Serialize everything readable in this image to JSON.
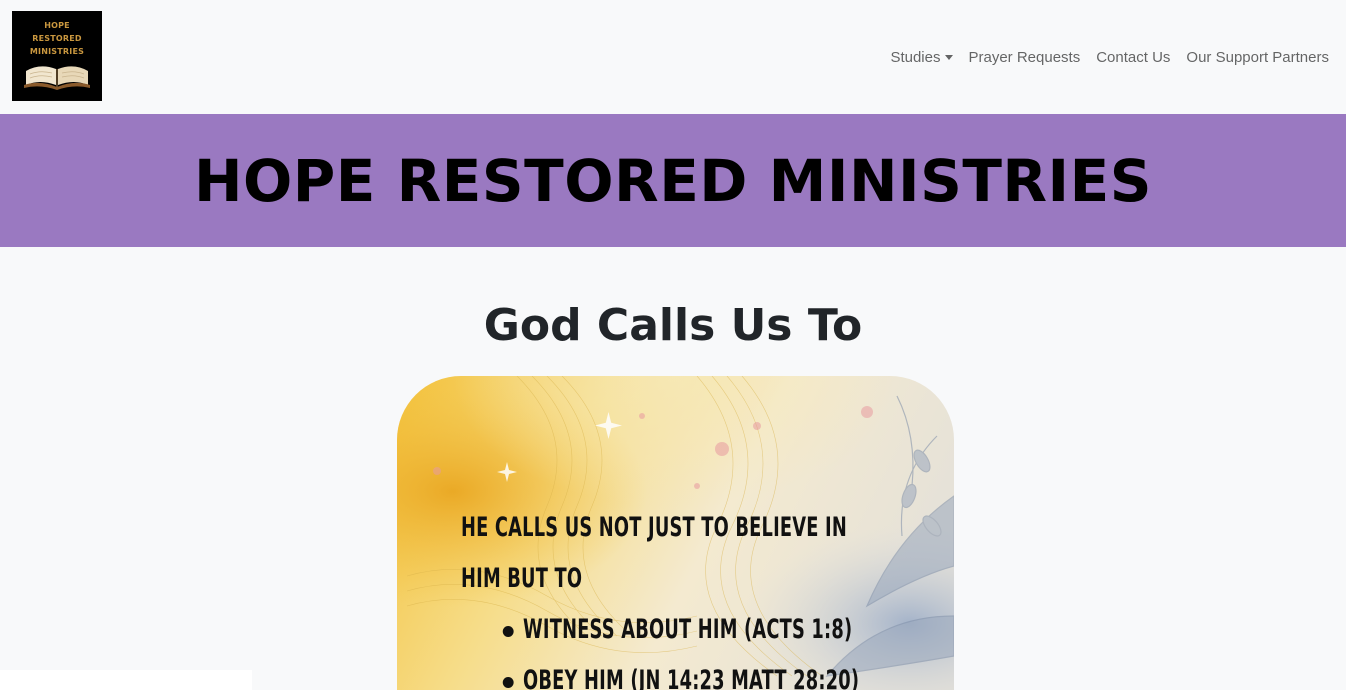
{
  "logo": {
    "alt": "Hope Restored Ministries logo",
    "lines": [
      "HOPE",
      "RESTORED",
      "MINISTRIES"
    ]
  },
  "nav": {
    "items": [
      {
        "label": "Studies",
        "has_dropdown": true
      },
      {
        "label": "Prayer Requests",
        "has_dropdown": false
      },
      {
        "label": "Contact Us",
        "has_dropdown": false
      },
      {
        "label": "Our Support Partners",
        "has_dropdown": false
      }
    ]
  },
  "hero": {
    "title": "HOPE RESTORED MINISTRIES",
    "background_color": "#9a79c1"
  },
  "section": {
    "title": "God Calls Us To"
  },
  "card": {
    "intro_line1": "HE CALLS US NOT JUST TO BELIEVE IN",
    "intro_line2": "HIM BUT TO",
    "bullets": [
      "WITNESS ABOUT HIM (ACTS 1:8)",
      "OBEY HIM (JN 14:23 MATT 28:20)"
    ]
  }
}
